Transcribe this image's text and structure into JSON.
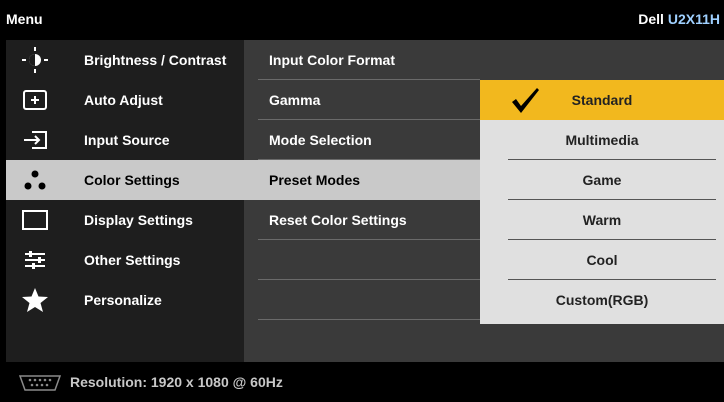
{
  "header": {
    "menu_label": "Menu",
    "brand": "Dell",
    "model": "U2X11H"
  },
  "left_menu": {
    "items": [
      {
        "label": "Brightness / Contrast",
        "icon": "brightness-icon"
      },
      {
        "label": "Auto Adjust",
        "icon": "auto-adjust-icon"
      },
      {
        "label": "Input Source",
        "icon": "input-source-icon"
      },
      {
        "label": "Color Settings",
        "icon": "color-settings-icon",
        "selected": true
      },
      {
        "label": "Display Settings",
        "icon": "display-settings-icon"
      },
      {
        "label": "Other Settings",
        "icon": "other-settings-icon"
      },
      {
        "label": "Personalize",
        "icon": "star-icon"
      }
    ]
  },
  "color_settings": {
    "items": [
      {
        "label": "Input Color Format"
      },
      {
        "label": "Gamma"
      },
      {
        "label": "Mode Selection"
      },
      {
        "label": "Preset Modes",
        "selected": true
      },
      {
        "label": "Reset Color Settings"
      }
    ]
  },
  "preset_modes": {
    "options": [
      {
        "label": "Standard",
        "selected": true
      },
      {
        "label": "Multimedia"
      },
      {
        "label": "Game"
      },
      {
        "label": "Warm"
      },
      {
        "label": "Cool"
      },
      {
        "label": "Custom(RGB)"
      }
    ]
  },
  "footer": {
    "resolution": "Resolution: 1920 x 1080 @ 60Hz",
    "connector_icon": "vga-icon"
  },
  "colors": {
    "selection": "#c9c9c9",
    "highlight": "#f2b81e",
    "panel": "#3a3a3a"
  }
}
